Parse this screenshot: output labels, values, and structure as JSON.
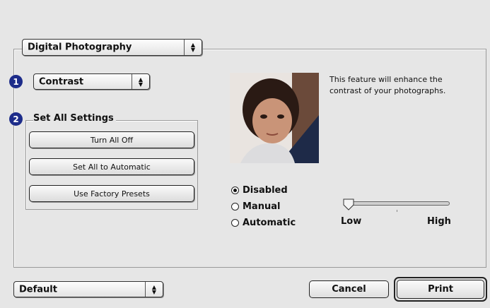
{
  "panel_select": {
    "value": "Digital Photography"
  },
  "feature": {
    "badge": "1",
    "select_value": "Contrast",
    "description_line1": "This feature will enhance the",
    "description_line2": "contrast of your photographs."
  },
  "set_all": {
    "badge": "2",
    "title": "Set All Settings",
    "buttons": [
      "Turn All Off",
      "Set All to Automatic",
      "Use Factory Presets"
    ]
  },
  "mode": {
    "options": [
      "Disabled",
      "Manual",
      "Automatic"
    ],
    "selected": "Disabled"
  },
  "slider": {
    "low_label": "Low",
    "high_label": "High",
    "value_fraction": 0.0
  },
  "footer": {
    "preset_value": "Default",
    "cancel_label": "Cancel",
    "print_label": "Print"
  },
  "colors": {
    "badge": "#1d2c8a",
    "background": "#e6e6e6"
  }
}
